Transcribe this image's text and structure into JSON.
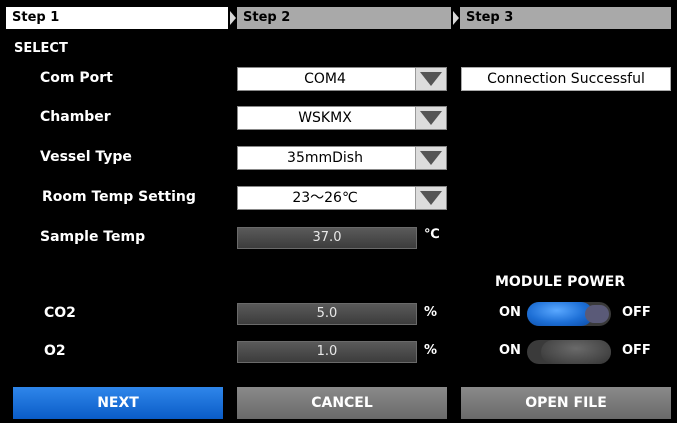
{
  "steps": [
    {
      "label": "Step 1",
      "active": true
    },
    {
      "label": "Step 2",
      "active": false
    },
    {
      "label": "Step 3",
      "active": false
    }
  ],
  "section_title": "SELECT",
  "com_port": {
    "label": "Com Port",
    "value": "COM4"
  },
  "connection_status": "Connection Successful",
  "chamber": {
    "label": "Chamber",
    "value": "WSKMX"
  },
  "vessel_type": {
    "label": "Vessel Type",
    "value": "35mmDish"
  },
  "room_temp": {
    "label": "Room Temp Setting",
    "value": "23～26℃"
  },
  "sample_temp": {
    "label": "Sample Temp",
    "value": "37.0",
    "unit": "℃"
  },
  "module_power": {
    "title": "MODULE POWER",
    "on_label": "ON",
    "off_label": "OFF"
  },
  "co2": {
    "label": "CO2",
    "value": "5.0",
    "unit": "%",
    "power": "on"
  },
  "o2": {
    "label": "O2",
    "value": "1.0",
    "unit": "%",
    "power": "off"
  },
  "buttons": {
    "next": "NEXT",
    "cancel": "CANCEL",
    "open_file": "OPEN FILE"
  },
  "colors": {
    "primary": "#0a5cc7",
    "active_tab": "#ffffff",
    "inactive_tab": "#a9a9a9"
  }
}
